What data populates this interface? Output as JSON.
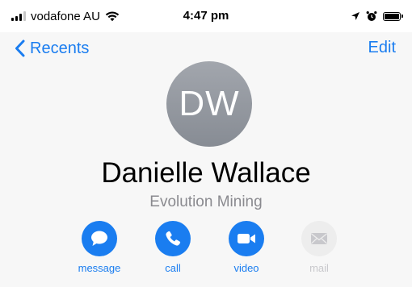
{
  "status_bar": {
    "carrier": "vodafone AU",
    "time": "4:47 pm"
  },
  "nav": {
    "back_label": "Recents",
    "edit_label": "Edit"
  },
  "contact": {
    "initials": "DW",
    "name": "Danielle Wallace",
    "company": "Evolution Mining"
  },
  "actions": [
    {
      "label": "message",
      "icon": "message-bubble-icon",
      "enabled": true
    },
    {
      "label": "call",
      "icon": "phone-icon",
      "enabled": true
    },
    {
      "label": "video",
      "icon": "video-camera-icon",
      "enabled": true
    },
    {
      "label": "mail",
      "icon": "mail-envelope-icon",
      "enabled": false
    }
  ],
  "colors": {
    "accent": "#1a7df0",
    "background": "#f7f7f7",
    "avatar": "#979ba2",
    "disabled": "#ededed"
  }
}
